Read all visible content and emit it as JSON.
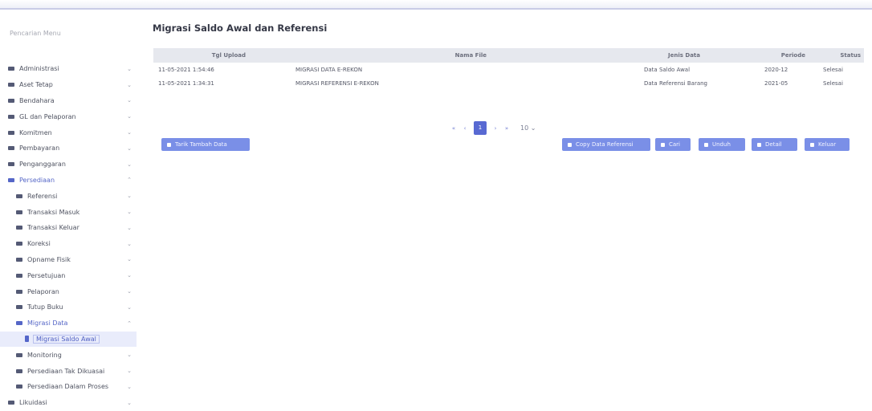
{
  "sidebar": {
    "search_placeholder": "Pencarian Menu",
    "items": [
      {
        "label": "Administrasi",
        "chevron": "⌄"
      },
      {
        "label": "Aset Tetap",
        "chevron": "⌄"
      },
      {
        "label": "Bendahara",
        "chevron": "⌄"
      },
      {
        "label": "GL dan Pelaporan",
        "chevron": "⌄"
      },
      {
        "label": "Komitmen",
        "chevron": "⌄"
      },
      {
        "label": "Pembayaran",
        "chevron": "⌄"
      },
      {
        "label": "Penganggaran",
        "chevron": "⌄"
      },
      {
        "label": "Persediaan",
        "chevron": "⌃"
      },
      {
        "label": "Referensi",
        "chevron": "⌄"
      },
      {
        "label": "Transaksi Masuk",
        "chevron": "⌄"
      },
      {
        "label": "Transaksi Keluar",
        "chevron": "⌄"
      },
      {
        "label": "Koreksi",
        "chevron": "⌄"
      },
      {
        "label": "Opname Fisik",
        "chevron": "⌄"
      },
      {
        "label": "Persetujuan",
        "chevron": "⌄"
      },
      {
        "label": "Pelaporan",
        "chevron": "⌄"
      },
      {
        "label": "Tutup Buku",
        "chevron": "⌄"
      },
      {
        "label": "Migrasi Data",
        "chevron": "⌃"
      },
      {
        "label": "Migrasi Saldo Awal"
      },
      {
        "label": "Monitoring",
        "chevron": "⌄"
      },
      {
        "label": "Persediaan Tak Dikuasai",
        "chevron": "⌄"
      },
      {
        "label": "Persediaan Dalam Proses",
        "chevron": "⌄"
      },
      {
        "label": "Likuidasi",
        "chevron": "⌄"
      }
    ]
  },
  "page": {
    "title": "Migrasi Saldo Awal dan Referensi"
  },
  "table": {
    "headers": {
      "tgl_upload": "Tgl Upload",
      "nama_file": "Nama File",
      "jenis_data": "Jenis Data",
      "periode": "Periode",
      "status": "Status"
    },
    "rows": [
      {
        "tgl_upload": "11-05-2021 1:54:46",
        "nama_file": "MIGRASI DATA E-REKON",
        "jenis_data": "Data Saldo Awal",
        "periode": "2020-12",
        "status": "Selesai"
      },
      {
        "tgl_upload": "11-05-2021 1:34:31",
        "nama_file": "MIGRASI REFERENSI E-REKON",
        "jenis_data": "Data Referensi Barang",
        "periode": "2021-05",
        "status": "Selesai"
      }
    ]
  },
  "pager": {
    "first": "«",
    "prev": "‹",
    "current": "1",
    "next": "›",
    "last": "»",
    "page_size": "10",
    "size_chevron": "⌄"
  },
  "buttons": {
    "tarik": "Tarik Tambah Data",
    "copy": "Copy Data Referensi",
    "cari": "Cari",
    "unduh": "Unduh",
    "detail": "Detail",
    "keluar": "Keluar"
  },
  "colors": {
    "accent": "#5869d2",
    "button": "#6f86e6",
    "header_bg": "#e6e8ee"
  }
}
